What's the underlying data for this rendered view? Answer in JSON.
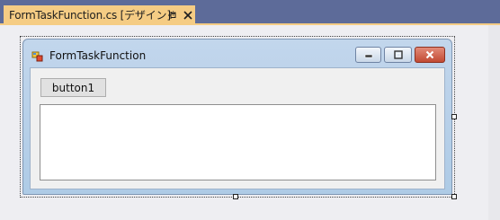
{
  "document_tab": {
    "title": "FormTaskFunction.cs [デザイン]*",
    "pin_icon": "pin-icon",
    "close_icon": "close-icon"
  },
  "form": {
    "title": "FormTaskFunction",
    "icon": "form-app-icon",
    "caption_buttons": [
      "minimize-icon",
      "maximize-icon",
      "close-icon"
    ]
  },
  "controls": {
    "button1_label": "button1",
    "textbox_value": ""
  },
  "colors": {
    "background": "#5d6b99",
    "tab_active": "#f5cc84",
    "designer_surface": "#eeeef2"
  }
}
